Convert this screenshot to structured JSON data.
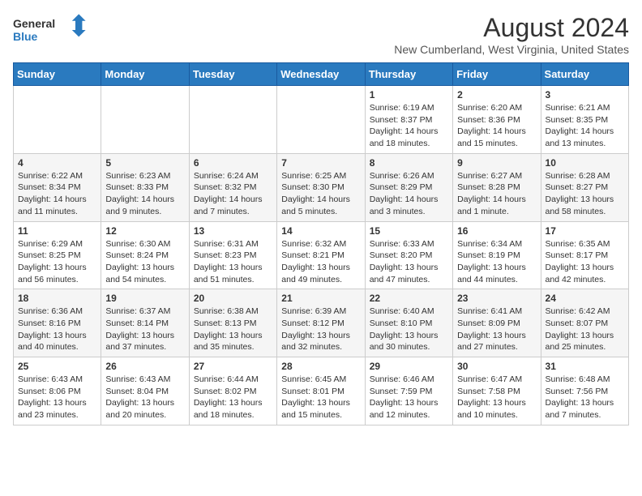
{
  "header": {
    "logo_line1": "General",
    "logo_line2": "Blue",
    "title": "August 2024",
    "subtitle": "New Cumberland, West Virginia, United States"
  },
  "days_of_week": [
    "Sunday",
    "Monday",
    "Tuesday",
    "Wednesday",
    "Thursday",
    "Friday",
    "Saturday"
  ],
  "weeks": [
    [
      {
        "day": "",
        "info": ""
      },
      {
        "day": "",
        "info": ""
      },
      {
        "day": "",
        "info": ""
      },
      {
        "day": "",
        "info": ""
      },
      {
        "day": "1",
        "info": "Sunrise: 6:19 AM\nSunset: 8:37 PM\nDaylight: 14 hours\nand 18 minutes."
      },
      {
        "day": "2",
        "info": "Sunrise: 6:20 AM\nSunset: 8:36 PM\nDaylight: 14 hours\nand 15 minutes."
      },
      {
        "day": "3",
        "info": "Sunrise: 6:21 AM\nSunset: 8:35 PM\nDaylight: 14 hours\nand 13 minutes."
      }
    ],
    [
      {
        "day": "4",
        "info": "Sunrise: 6:22 AM\nSunset: 8:34 PM\nDaylight: 14 hours\nand 11 minutes."
      },
      {
        "day": "5",
        "info": "Sunrise: 6:23 AM\nSunset: 8:33 PM\nDaylight: 14 hours\nand 9 minutes."
      },
      {
        "day": "6",
        "info": "Sunrise: 6:24 AM\nSunset: 8:32 PM\nDaylight: 14 hours\nand 7 minutes."
      },
      {
        "day": "7",
        "info": "Sunrise: 6:25 AM\nSunset: 8:30 PM\nDaylight: 14 hours\nand 5 minutes."
      },
      {
        "day": "8",
        "info": "Sunrise: 6:26 AM\nSunset: 8:29 PM\nDaylight: 14 hours\nand 3 minutes."
      },
      {
        "day": "9",
        "info": "Sunrise: 6:27 AM\nSunset: 8:28 PM\nDaylight: 14 hours\nand 1 minute."
      },
      {
        "day": "10",
        "info": "Sunrise: 6:28 AM\nSunset: 8:27 PM\nDaylight: 13 hours\nand 58 minutes."
      }
    ],
    [
      {
        "day": "11",
        "info": "Sunrise: 6:29 AM\nSunset: 8:25 PM\nDaylight: 13 hours\nand 56 minutes."
      },
      {
        "day": "12",
        "info": "Sunrise: 6:30 AM\nSunset: 8:24 PM\nDaylight: 13 hours\nand 54 minutes."
      },
      {
        "day": "13",
        "info": "Sunrise: 6:31 AM\nSunset: 8:23 PM\nDaylight: 13 hours\nand 51 minutes."
      },
      {
        "day": "14",
        "info": "Sunrise: 6:32 AM\nSunset: 8:21 PM\nDaylight: 13 hours\nand 49 minutes."
      },
      {
        "day": "15",
        "info": "Sunrise: 6:33 AM\nSunset: 8:20 PM\nDaylight: 13 hours\nand 47 minutes."
      },
      {
        "day": "16",
        "info": "Sunrise: 6:34 AM\nSunset: 8:19 PM\nDaylight: 13 hours\nand 44 minutes."
      },
      {
        "day": "17",
        "info": "Sunrise: 6:35 AM\nSunset: 8:17 PM\nDaylight: 13 hours\nand 42 minutes."
      }
    ],
    [
      {
        "day": "18",
        "info": "Sunrise: 6:36 AM\nSunset: 8:16 PM\nDaylight: 13 hours\nand 40 minutes."
      },
      {
        "day": "19",
        "info": "Sunrise: 6:37 AM\nSunset: 8:14 PM\nDaylight: 13 hours\nand 37 minutes."
      },
      {
        "day": "20",
        "info": "Sunrise: 6:38 AM\nSunset: 8:13 PM\nDaylight: 13 hours\nand 35 minutes."
      },
      {
        "day": "21",
        "info": "Sunrise: 6:39 AM\nSunset: 8:12 PM\nDaylight: 13 hours\nand 32 minutes."
      },
      {
        "day": "22",
        "info": "Sunrise: 6:40 AM\nSunset: 8:10 PM\nDaylight: 13 hours\nand 30 minutes."
      },
      {
        "day": "23",
        "info": "Sunrise: 6:41 AM\nSunset: 8:09 PM\nDaylight: 13 hours\nand 27 minutes."
      },
      {
        "day": "24",
        "info": "Sunrise: 6:42 AM\nSunset: 8:07 PM\nDaylight: 13 hours\nand 25 minutes."
      }
    ],
    [
      {
        "day": "25",
        "info": "Sunrise: 6:43 AM\nSunset: 8:06 PM\nDaylight: 13 hours\nand 23 minutes."
      },
      {
        "day": "26",
        "info": "Sunrise: 6:43 AM\nSunset: 8:04 PM\nDaylight: 13 hours\nand 20 minutes."
      },
      {
        "day": "27",
        "info": "Sunrise: 6:44 AM\nSunset: 8:02 PM\nDaylight: 13 hours\nand 18 minutes."
      },
      {
        "day": "28",
        "info": "Sunrise: 6:45 AM\nSunset: 8:01 PM\nDaylight: 13 hours\nand 15 minutes."
      },
      {
        "day": "29",
        "info": "Sunrise: 6:46 AM\nSunset: 7:59 PM\nDaylight: 13 hours\nand 12 minutes."
      },
      {
        "day": "30",
        "info": "Sunrise: 6:47 AM\nSunset: 7:58 PM\nDaylight: 13 hours\nand 10 minutes."
      },
      {
        "day": "31",
        "info": "Sunrise: 6:48 AM\nSunset: 7:56 PM\nDaylight: 13 hours\nand 7 minutes."
      }
    ]
  ]
}
